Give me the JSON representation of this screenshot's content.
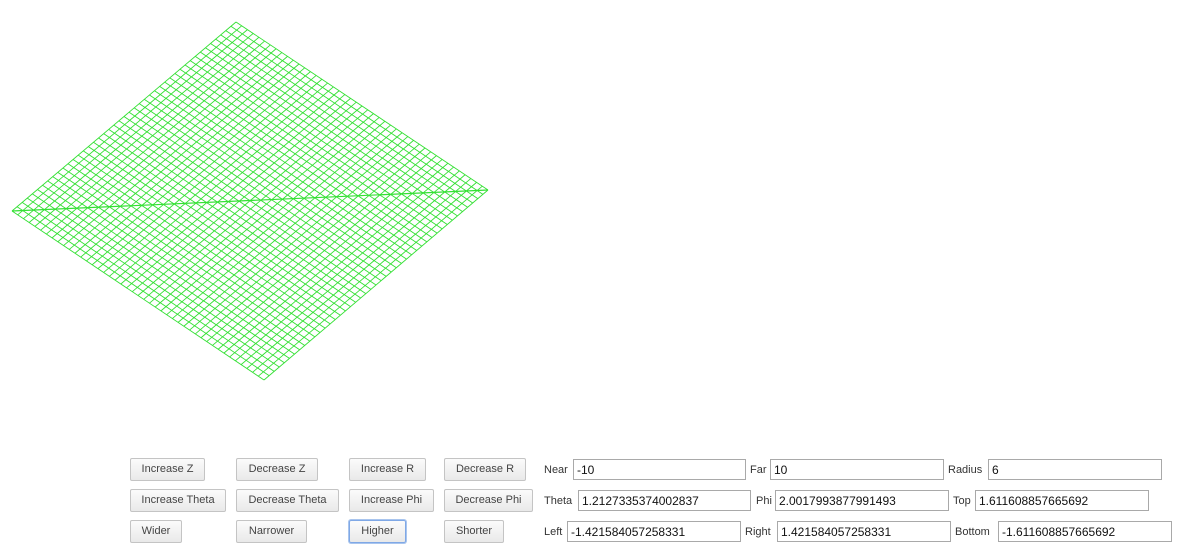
{
  "viewport": {
    "line_color": "#33e033",
    "background": "#ffffff"
  },
  "buttons": {
    "increase_z": "Increase Z",
    "decrease_z": "Decrease Z",
    "increase_r": "Increase R",
    "decrease_r": "Decrease R",
    "increase_theta": "Increase Theta",
    "decrease_theta": "Decrease Theta",
    "increase_phi": "Increase Phi",
    "decrease_phi": "Decrease Phi",
    "wider": "Wider",
    "narrower": "Narrower",
    "higher": "Higher",
    "shorter": "Shorter"
  },
  "fields": {
    "near": {
      "label": "Near",
      "value": "-10"
    },
    "far": {
      "label": "Far",
      "value": "10"
    },
    "radius": {
      "label": "Radius",
      "value": "6"
    },
    "theta": {
      "label": "Theta",
      "value": "1.2127335374002837"
    },
    "phi": {
      "label": "Phi",
      "value": "2.0017993877991493"
    },
    "top": {
      "label": "Top",
      "value": "1.611608857665692"
    },
    "left": {
      "label": "Left",
      "value": "-1.421584057258331"
    },
    "right": {
      "label": "Right",
      "value": "1.421584057258331"
    },
    "bottom": {
      "label": "Bottom",
      "value": "-1.611608857665692"
    }
  }
}
